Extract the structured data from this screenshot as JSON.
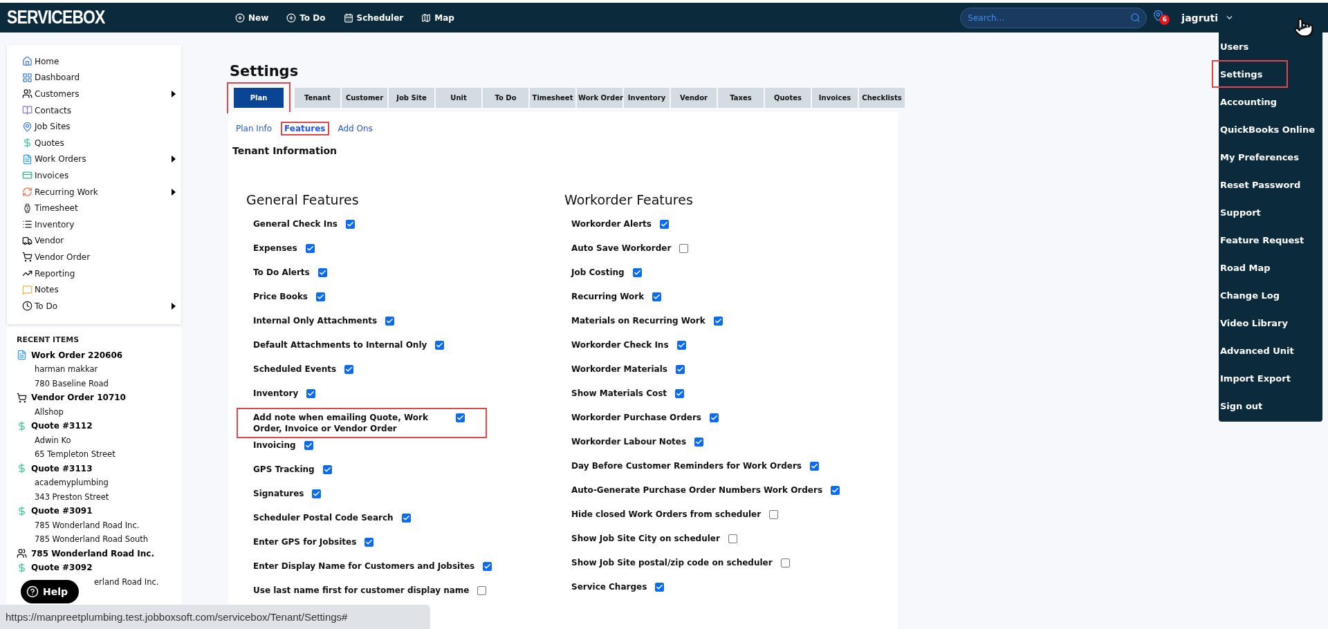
{
  "app": {
    "logo": "SERVICEBOX"
  },
  "top_nav": [
    {
      "label": "New"
    },
    {
      "label": "To Do"
    },
    {
      "label": "Scheduler"
    },
    {
      "label": "Map"
    }
  ],
  "search": {
    "placeholder": "Search..."
  },
  "notifications": {
    "badge": "6"
  },
  "user": {
    "name": "jagruti"
  },
  "user_menu": [
    {
      "label": "Users",
      "highlighted": false
    },
    {
      "label": "Settings",
      "highlighted": true
    },
    {
      "label": "Accounting",
      "highlighted": false
    },
    {
      "label": "QuickBooks Online",
      "highlighted": false
    },
    {
      "label": "My Preferences",
      "highlighted": false
    },
    {
      "label": "Reset Password",
      "highlighted": false
    },
    {
      "label": "Support",
      "highlighted": false
    },
    {
      "label": "Feature Request",
      "highlighted": false
    },
    {
      "label": "Road Map",
      "highlighted": false
    },
    {
      "label": "Change Log",
      "highlighted": false
    },
    {
      "label": "Video Library",
      "highlighted": false
    },
    {
      "label": "Advanced Unit",
      "highlighted": false
    },
    {
      "label": "Import Export",
      "highlighted": false
    },
    {
      "label": "Sign out",
      "highlighted": false
    }
  ],
  "sidebar": {
    "items": [
      {
        "label": "Home",
        "has_submenu": false
      },
      {
        "label": "Dashboard",
        "has_submenu": false
      },
      {
        "label": "Customers",
        "has_submenu": true
      },
      {
        "label": "Contacts",
        "has_submenu": false
      },
      {
        "label": "Job Sites",
        "has_submenu": false
      },
      {
        "label": "Quotes",
        "has_submenu": false
      },
      {
        "label": "Work Orders",
        "has_submenu": true
      },
      {
        "label": "Invoices",
        "has_submenu": false
      },
      {
        "label": "Recurring Work",
        "has_submenu": true
      },
      {
        "label": "Timesheet",
        "has_submenu": false
      },
      {
        "label": "Inventory",
        "has_submenu": false
      },
      {
        "label": "Vendor",
        "has_submenu": false
      },
      {
        "label": "Vendor Order",
        "has_submenu": false
      },
      {
        "label": "Reporting",
        "has_submenu": false
      },
      {
        "label": "Notes",
        "has_submenu": false
      },
      {
        "label": "To Do",
        "has_submenu": true
      }
    ]
  },
  "recent_items": {
    "title": "RECENT ITEMS",
    "items": [
      {
        "kind": "work-order",
        "title": "Work Order 220606",
        "lines": [
          "harman makkar",
          "780 Baseline Road"
        ]
      },
      {
        "kind": "vendor-order",
        "title": "Vendor Order 10710",
        "lines": [
          "Allshop"
        ]
      },
      {
        "kind": "quote",
        "title": "Quote #3112",
        "lines": [
          "Adwin Ko",
          "65 Templeton Street"
        ]
      },
      {
        "kind": "quote",
        "title": "Quote #3113",
        "lines": [
          "academyplumbing",
          "343 Preston Street"
        ]
      },
      {
        "kind": "quote",
        "title": "Quote #3091",
        "lines": [
          "785 Wonderland Road Inc.",
          "785 Wonderland Road South"
        ]
      },
      {
        "kind": "customer",
        "title": "785 Wonderland Road Inc."
      },
      {
        "kind": "quote",
        "title": "Quote #3092",
        "lines": [
          "erland Road Inc."
        ]
      }
    ]
  },
  "help_button": {
    "label": "Help"
  },
  "page": {
    "title": "Settings"
  },
  "tabs": [
    {
      "label": "Plan",
      "selected": true,
      "highlighted": true
    },
    {
      "label": "Tenant",
      "selected": false,
      "highlighted": false
    },
    {
      "label": "Customer",
      "selected": false,
      "highlighted": false
    },
    {
      "label": "Job Site",
      "selected": false,
      "highlighted": false
    },
    {
      "label": "Unit",
      "selected": false,
      "highlighted": false
    },
    {
      "label": "To Do",
      "selected": false,
      "highlighted": false
    },
    {
      "label": "Timesheet",
      "selected": false,
      "highlighted": false
    },
    {
      "label": "Work Order",
      "selected": false,
      "highlighted": false
    },
    {
      "label": "Inventory",
      "selected": false,
      "highlighted": false
    },
    {
      "label": "Vendor",
      "selected": false,
      "highlighted": false
    },
    {
      "label": "Taxes",
      "selected": false,
      "highlighted": false
    },
    {
      "label": "Quotes",
      "selected": false,
      "highlighted": false
    },
    {
      "label": "Invoices",
      "selected": false,
      "highlighted": false
    },
    {
      "label": "Checklists",
      "selected": false,
      "highlighted": false
    }
  ],
  "subtabs": [
    {
      "label": "Plan Info",
      "selected": false,
      "highlighted": false
    },
    {
      "label": "Features",
      "selected": true,
      "highlighted": true
    },
    {
      "label": "Add Ons",
      "selected": false,
      "highlighted": false
    }
  ],
  "section_title": "Tenant Information",
  "feature_groups": [
    {
      "title": "General Features",
      "features": [
        {
          "label": "General Check Ins",
          "checked": true,
          "highlighted": false
        },
        {
          "label": "Expenses",
          "checked": true,
          "highlighted": false
        },
        {
          "label": "To Do Alerts",
          "checked": true,
          "highlighted": false
        },
        {
          "label": "Price Books",
          "checked": true,
          "highlighted": false
        },
        {
          "label": "Internal Only Attachments",
          "checked": true,
          "highlighted": false
        },
        {
          "label": "Default Attachments to Internal Only",
          "checked": true,
          "highlighted": false
        },
        {
          "label": "Scheduled Events",
          "checked": true,
          "highlighted": false
        },
        {
          "label": "Inventory",
          "checked": true,
          "highlighted": false
        },
        {
          "label": "Add note when emailing Quote, Work Order, Invoice or Vendor Order",
          "checked": true,
          "highlighted": true
        },
        {
          "label": "Invoicing",
          "checked": true,
          "highlighted": false
        },
        {
          "label": "GPS Tracking",
          "checked": true,
          "highlighted": false
        },
        {
          "label": "Signatures",
          "checked": true,
          "highlighted": false
        },
        {
          "label": "Scheduler Postal Code Search",
          "checked": true,
          "highlighted": false
        },
        {
          "label": "Enter GPS for Jobsites",
          "checked": true,
          "highlighted": false
        },
        {
          "label": "Enter Display Name for Customers and Jobsites",
          "checked": true,
          "highlighted": false
        },
        {
          "label": "Use last name first for customer display name",
          "checked": false,
          "highlighted": false
        }
      ]
    },
    {
      "title": "Workorder Features",
      "features": [
        {
          "label": "Workorder Alerts",
          "checked": true,
          "highlighted": false
        },
        {
          "label": "Auto Save Workorder",
          "checked": false,
          "highlighted": false
        },
        {
          "label": "Job Costing",
          "checked": true,
          "highlighted": false
        },
        {
          "label": "Recurring Work",
          "checked": true,
          "highlighted": false
        },
        {
          "label": "Materials on Recurring Work",
          "checked": true,
          "highlighted": false
        },
        {
          "label": "Workorder Check Ins",
          "checked": true,
          "highlighted": false
        },
        {
          "label": "Workorder Materials",
          "checked": true,
          "highlighted": false
        },
        {
          "label": "Show Materials Cost",
          "checked": true,
          "highlighted": false
        },
        {
          "label": "Workorder Purchase Orders",
          "checked": true,
          "highlighted": false
        },
        {
          "label": "Workorder Labour Notes",
          "checked": true,
          "highlighted": false
        },
        {
          "label": "Day Before Customer Reminders for Work Orders",
          "checked": true,
          "highlighted": false
        },
        {
          "label": "Auto-Generate Purchase Order Numbers Work Orders",
          "checked": true,
          "highlighted": false
        },
        {
          "label": "Hide closed Work Orders from scheduler",
          "checked": false,
          "highlighted": false
        },
        {
          "label": "Show Job Site City on scheduler",
          "checked": false,
          "highlighted": false
        },
        {
          "label": "Show Job Site postal/zip code on scheduler",
          "checked": false,
          "highlighted": false
        },
        {
          "label": "Service Charges",
          "checked": true,
          "highlighted": false
        }
      ]
    }
  ],
  "status_bar": {
    "url": "https://manpreetplumbing.test.jobboxsoft.com/servicebox/Tenant/Settings#"
  }
}
